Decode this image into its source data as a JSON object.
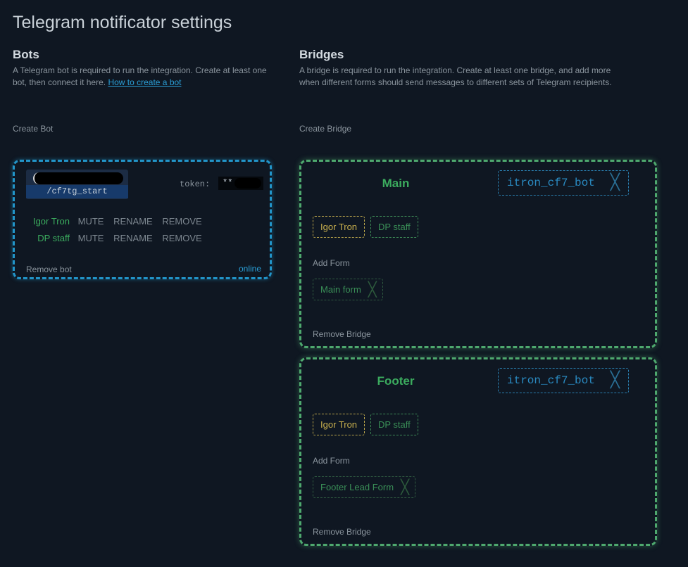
{
  "page_title": "Telegram notificator settings",
  "bots_section": {
    "title": "Bots",
    "description": "A Telegram bot is required to run the integration. Create at least one bot, then connect it here.",
    "how_to_link": "How to create a bot",
    "create_label": "Create Bot",
    "bot": {
      "start_command": "/cf7tg_start",
      "token_label": "token:",
      "token_value": "**",
      "recipients": [
        {
          "name": "Igor Tron",
          "actions": [
            "MUTE",
            "RENAME",
            "REMOVE"
          ]
        },
        {
          "name": "DP staff",
          "actions": [
            "MUTE",
            "RENAME",
            "REMOVE"
          ]
        }
      ],
      "remove_label": "Remove bot",
      "status": "online"
    },
    "colors": {
      "bot_border": "#2295c9"
    }
  },
  "bridges_section": {
    "title": "Bridges",
    "description": "A bridge is required to run the integration. Create at least one bridge, and add more when different forms should send messages to different sets of Telegram recipients.",
    "create_label": "Create Bridge",
    "colors": {
      "bridge_border": "#4ea86e"
    },
    "bridges": [
      {
        "name": "Main",
        "bot": "itron_cf7_bot",
        "recipients": [
          "Igor Tron",
          "DP staff"
        ],
        "add_form_label": "Add Form",
        "form": "Main form",
        "remove_label": "Remove Bridge"
      },
      {
        "name": "Footer",
        "bot": "itron_cf7_bot",
        "recipients": [
          "Igor Tron",
          "DP staff"
        ],
        "add_form_label": "Add Form",
        "form": "Footer Lead Form",
        "remove_label": "Remove Bridge"
      }
    ]
  }
}
